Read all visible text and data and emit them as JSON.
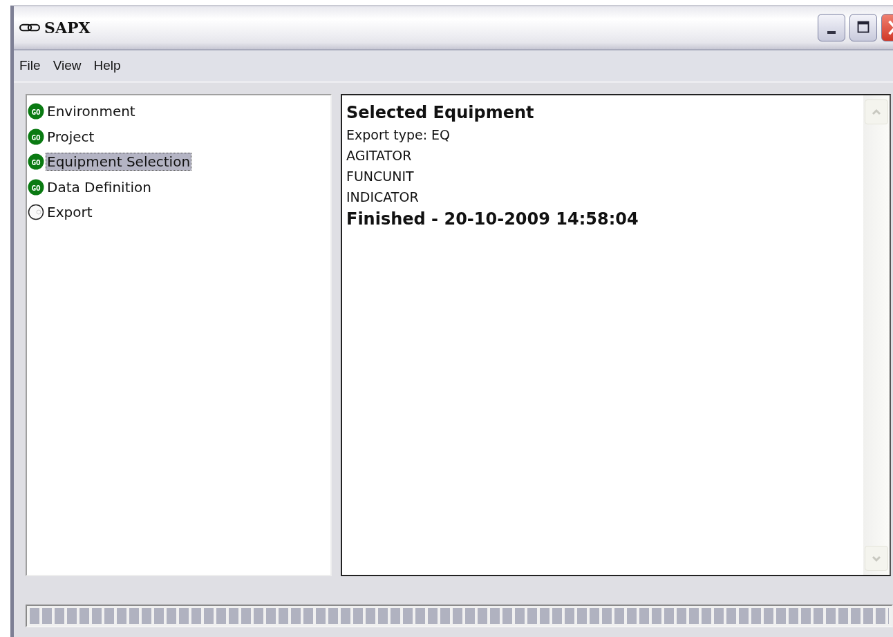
{
  "window": {
    "title": "SAPX"
  },
  "menu": [
    "File",
    "View",
    "Help"
  ],
  "steps": [
    {
      "label": "Environment",
      "done": true,
      "badge": "GO",
      "selected": false
    },
    {
      "label": "Project",
      "done": true,
      "badge": "GO",
      "selected": false
    },
    {
      "label": "Equipment Selection",
      "done": true,
      "badge": "GO",
      "selected": true
    },
    {
      "label": "Data Definition",
      "done": true,
      "badge": "GO",
      "selected": false
    },
    {
      "label": "Export",
      "done": false,
      "selected": false
    }
  ],
  "log": [
    {
      "kind": "heading",
      "text": "Selected Equipment"
    },
    {
      "kind": "text",
      "text": "Export type: EQ"
    },
    {
      "kind": "text",
      "text": "AGITATOR"
    },
    {
      "kind": "text",
      "text": "FUNCUNIT"
    },
    {
      "kind": "text",
      "text": "INDICATOR"
    },
    {
      "kind": "heading",
      "text": "Finished - 20-10-2009 14:58:04"
    }
  ],
  "progress": {
    "level": 1
  }
}
